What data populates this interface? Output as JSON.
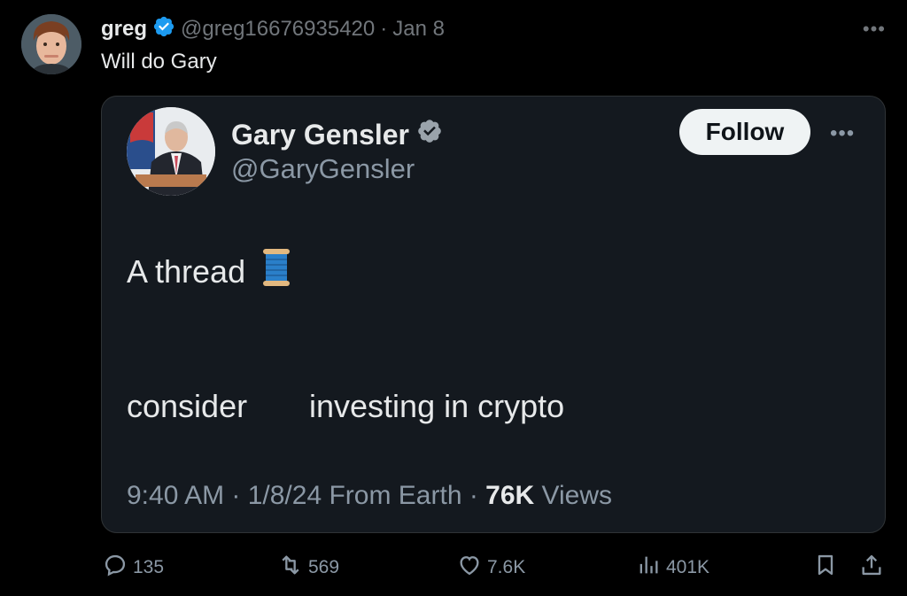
{
  "tweet": {
    "author_name": "greg",
    "handle": "@greg16676935420",
    "date": "Jan 8",
    "separator": "·",
    "text": "Will do Gary",
    "more_icon": "more-icon"
  },
  "quote": {
    "author_name": "Gary Gensler",
    "handle": "@GaryGensler",
    "follow_label": "Follow",
    "line1": "A thread",
    "line2_part1": "consider",
    "line2_part2": "investing in crypto",
    "time": "9:40 AM · 1/8/24 From Earth · ",
    "views_count": "76K",
    "views_label": " Views"
  },
  "actions": {
    "replies": "135",
    "retweets": "569",
    "likes": "7.6K",
    "views": "401K"
  },
  "colors": {
    "background": "#000000",
    "card": "#14191f",
    "verified": "#1d9bf0",
    "muted": "#71767b"
  }
}
